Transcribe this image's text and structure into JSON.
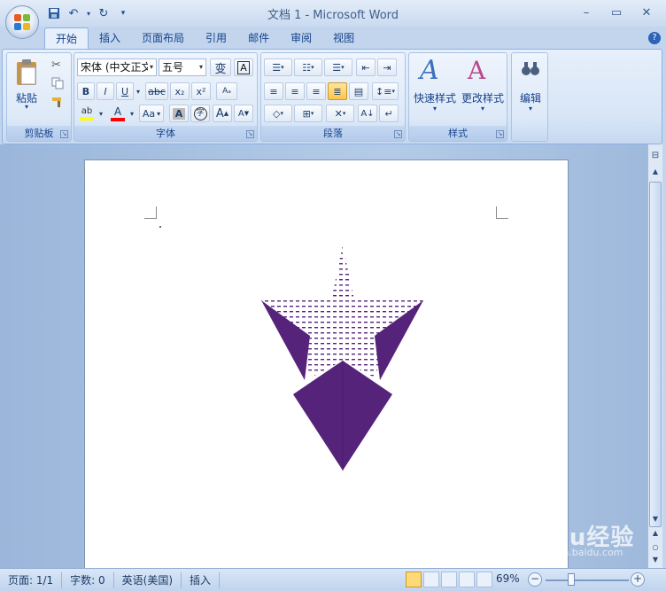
{
  "window": {
    "title": "文档 1 - Microsoft Word"
  },
  "tabs": [
    {
      "label": "开始",
      "active": true
    },
    {
      "label": "插入"
    },
    {
      "label": "页面布局"
    },
    {
      "label": "引用"
    },
    {
      "label": "邮件"
    },
    {
      "label": "审阅"
    },
    {
      "label": "视图"
    }
  ],
  "groups": {
    "clipboard": {
      "label": "剪贴板",
      "paste_label": "粘贴"
    },
    "font": {
      "label": "字体",
      "font_name": "宋体 (中文正文)",
      "font_size": "五号",
      "bold": "B",
      "italic": "I",
      "underline": "U",
      "strike": "abc",
      "subscript": "x₂",
      "superscript": "x²",
      "change_case": "Aa",
      "char_shade": "A",
      "enclose": "字",
      "grow": "A",
      "shrink": "A"
    },
    "paragraph": {
      "label": "段落"
    },
    "styles": {
      "label": "样式",
      "quick_styles": "快速样式",
      "change_styles": "更改样式"
    },
    "editing": {
      "label": "编辑"
    }
  },
  "statusbar": {
    "page": "页面: 1/1",
    "words": "字数: 0",
    "language": "英语(美国)",
    "mode": "插入",
    "zoom": "69%"
  },
  "watermark": {
    "text": "Baidu经验",
    "sub": "jingyan.baidu.com"
  },
  "colors": {
    "shape_fill": "#56237a",
    "accent": "#15428b",
    "highlight": "#ffff00",
    "font_color": "#ff0000"
  }
}
